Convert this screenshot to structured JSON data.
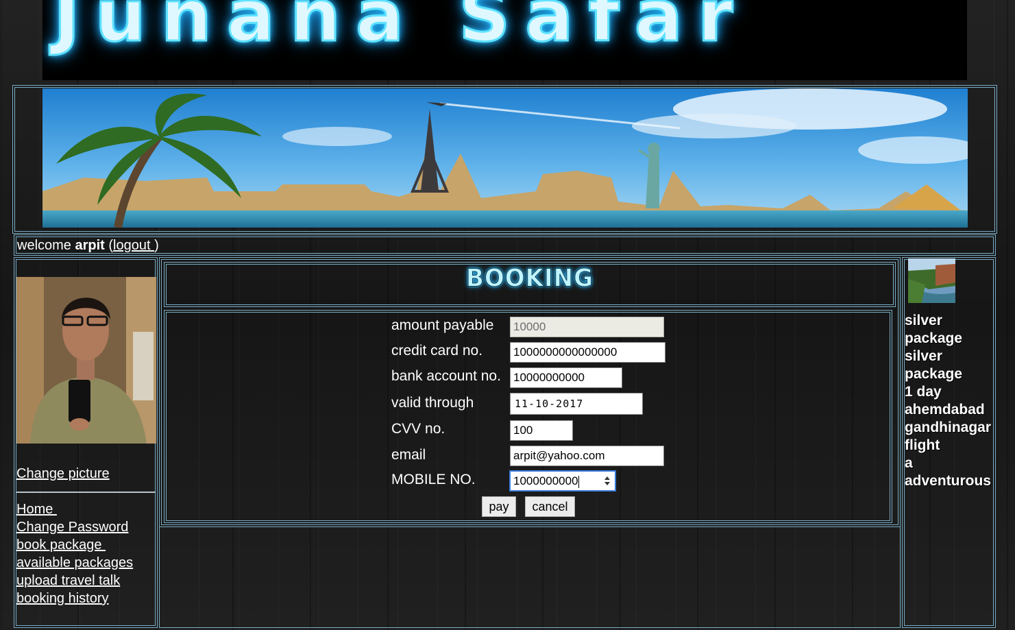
{
  "logo": {
    "text": "Junana Safar"
  },
  "welcome": {
    "prefix": "welcome ",
    "username": "arpit",
    "open_paren": " (",
    "logout_label": "logout ",
    "close_paren": ")"
  },
  "sidebar": {
    "change_picture": "Change picture",
    "nav": [
      "Home ",
      "Change Password",
      "book package ",
      "available packages",
      "upload travel talk",
      "booking history"
    ]
  },
  "main": {
    "title": "BOOKING",
    "form": {
      "amount_payable": {
        "label": "amount payable",
        "value": "10000"
      },
      "credit_card": {
        "label": "credit card no.",
        "value": "1000000000000000"
      },
      "bank_account": {
        "label": "bank account no.",
        "value": "10000000000"
      },
      "valid_through": {
        "label": "valid through",
        "value": "11-10-2017"
      },
      "cvv": {
        "label": "CVV no.",
        "value": "100"
      },
      "email": {
        "label": "email",
        "value": "arpit@yahoo.com"
      },
      "mobile": {
        "label": "MOBILE NO.",
        "value": "1000000000"
      },
      "pay_label": "pay",
      "cancel_label": "cancel"
    }
  },
  "package": {
    "lines": [
      "silver",
      "package",
      "silver",
      "package",
      "1 day",
      "ahemdabad",
      "gandhinagar",
      "flight",
      "a",
      "adventurous"
    ]
  },
  "colors": {
    "frame": "#7aaec6",
    "neon": "#3fd0ff",
    "focus": "#3b7ddd"
  }
}
